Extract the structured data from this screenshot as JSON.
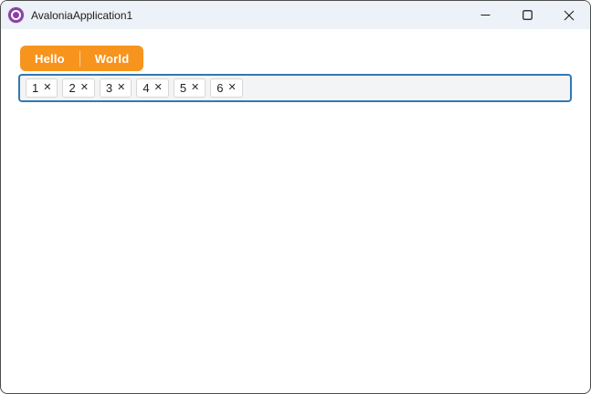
{
  "window": {
    "title": "AvaloniaApplication1",
    "icons": {
      "app_logo": "avalonia-logo-purple-donut",
      "minimize": "thin-horizontal-dash",
      "maximize": "square-outline",
      "close": "thin-x"
    }
  },
  "tabs": [
    {
      "label": "Hello"
    },
    {
      "label": "World"
    }
  ],
  "chips": {
    "items": [
      {
        "label": "1"
      },
      {
        "label": "2"
      },
      {
        "label": "3"
      },
      {
        "label": "4"
      },
      {
        "label": "5"
      },
      {
        "label": "6"
      }
    ],
    "remove_glyph": "✕"
  },
  "colors": {
    "accent_orange": "#F7941E",
    "focus_border": "#3178B5",
    "titlebar_bg": "#EDF2F8",
    "logo_purple": "#8B3FA8",
    "window_border": "#4D4D4D"
  }
}
